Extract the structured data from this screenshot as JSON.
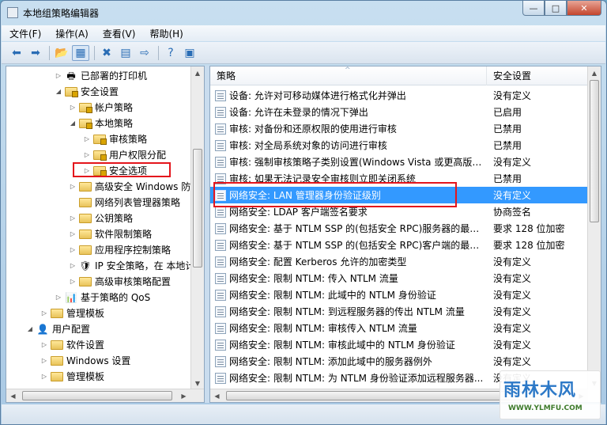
{
  "window": {
    "title": "本地组策略编辑器",
    "min_label": "—",
    "max_label": "□",
    "close_label": "✕"
  },
  "menu": [
    "文件(F)",
    "操作(A)",
    "查看(V)",
    "帮助(H)"
  ],
  "toolbar": {
    "icons": [
      "back-arrow-icon",
      "forward-arrow-icon",
      "folder-up-icon",
      "console-tree-icon",
      "delete-icon",
      "properties-icon",
      "export-icon",
      "help-icon",
      "show-hide-icon"
    ],
    "glyphs": [
      "⬅",
      "➡",
      "📂",
      "▦",
      "✖",
      "▤",
      "⇨",
      "?",
      "▣"
    ]
  },
  "tree": [
    {
      "label": "已部署的打印机",
      "indent": 3,
      "twisty": "▷",
      "icon": "printer"
    },
    {
      "label": "安全设置",
      "indent": 3,
      "twisty": "◢",
      "icon": "folder-lock"
    },
    {
      "label": "帐户策略",
      "indent": 4,
      "twisty": "▷",
      "icon": "folder-lock"
    },
    {
      "label": "本地策略",
      "indent": 4,
      "twisty": "◢",
      "icon": "folder-lock"
    },
    {
      "label": "审核策略",
      "indent": 5,
      "twisty": "▷",
      "icon": "folder-lock"
    },
    {
      "label": "用户权限分配",
      "indent": 5,
      "twisty": "▷",
      "icon": "folder-lock"
    },
    {
      "label": "安全选项",
      "indent": 5,
      "twisty": "▷",
      "icon": "folder-lock"
    },
    {
      "label": "高级安全 Windows 防火墙",
      "indent": 4,
      "twisty": "▷",
      "icon": "folder"
    },
    {
      "label": "网络列表管理器策略",
      "indent": 4,
      "twisty": "",
      "icon": "folder"
    },
    {
      "label": "公钥策略",
      "indent": 4,
      "twisty": "▷",
      "icon": "folder"
    },
    {
      "label": "软件限制策略",
      "indent": 4,
      "twisty": "▷",
      "icon": "folder"
    },
    {
      "label": "应用程序控制策略",
      "indent": 4,
      "twisty": "▷",
      "icon": "folder"
    },
    {
      "label": "IP 安全策略，在 本地计算机",
      "indent": 4,
      "twisty": "▷",
      "icon": "shield"
    },
    {
      "label": "高级审核策略配置",
      "indent": 4,
      "twisty": "▷",
      "icon": "folder"
    },
    {
      "label": "基于策略的 QoS",
      "indent": 3,
      "twisty": "▷",
      "icon": "chart"
    },
    {
      "label": "管理模板",
      "indent": 2,
      "twisty": "▷",
      "icon": "folder"
    },
    {
      "label": "用户配置",
      "indent": 1,
      "twisty": "◢",
      "icon": "user"
    },
    {
      "label": "软件设置",
      "indent": 2,
      "twisty": "▷",
      "icon": "folder"
    },
    {
      "label": "Windows 设置",
      "indent": 2,
      "twisty": "▷",
      "icon": "folder"
    },
    {
      "label": "管理模板",
      "indent": 2,
      "twisty": "▷",
      "icon": "folder"
    }
  ],
  "list": {
    "col_policy": "策略",
    "col_setting": "安全设置",
    "rows": [
      {
        "policy": "设备: 允许对可移动媒体进行格式化并弹出",
        "setting": "没有定义"
      },
      {
        "policy": "设备: 允许在未登录的情况下弹出",
        "setting": "已启用"
      },
      {
        "policy": "审核: 对备份和还原权限的使用进行审核",
        "setting": "已禁用"
      },
      {
        "policy": "审核: 对全局系统对象的访问进行审核",
        "setting": "已禁用"
      },
      {
        "policy": "审核: 强制审核策略子类别设置(Windows Vista 或更高版本...",
        "setting": "没有定义"
      },
      {
        "policy": "审核: 如果无法记录安全审核则立即关闭系统",
        "setting": "已禁用"
      },
      {
        "policy": "网络安全: LAN 管理器身份验证级别",
        "setting": "没有定义",
        "selected": true
      },
      {
        "policy": "网络安全: LDAP 客户端签名要求",
        "setting": "协商签名"
      },
      {
        "policy": "网络安全: 基于 NTLM SSP 的(包括安全 RPC)服务器的最小...",
        "setting": "要求 128 位加密"
      },
      {
        "policy": "网络安全: 基于 NTLM SSP 的(包括安全 RPC)客户端的最小...",
        "setting": "要求 128 位加密"
      },
      {
        "policy": "网络安全: 配置 Kerberos 允许的加密类型",
        "setting": "没有定义"
      },
      {
        "policy": "网络安全: 限制 NTLM: 传入 NTLM 流量",
        "setting": "没有定义"
      },
      {
        "policy": "网络安全: 限制 NTLM: 此域中的 NTLM 身份验证",
        "setting": "没有定义"
      },
      {
        "policy": "网络安全: 限制 NTLM: 到远程服务器的传出 NTLM 流量",
        "setting": "没有定义"
      },
      {
        "policy": "网络安全: 限制 NTLM: 审核传入 NTLM 流量",
        "setting": "没有定义"
      },
      {
        "policy": "网络安全: 限制 NTLM: 审核此域中的 NTLM 身份验证",
        "setting": "没有定义"
      },
      {
        "policy": "网络安全: 限制 NTLM: 添加此域中的服务器例外",
        "setting": "没有定义"
      },
      {
        "policy": "网络安全: 限制 NTLM: 为 NTLM 身份验证添加远程服务器...",
        "setting": "没有定义"
      }
    ]
  },
  "watermark": {
    "main": "雨林木风",
    "sub": "WWW.YLMFU.COM"
  },
  "colors": {
    "selection": "#3399ff",
    "highlight_box": "#e4151c"
  }
}
